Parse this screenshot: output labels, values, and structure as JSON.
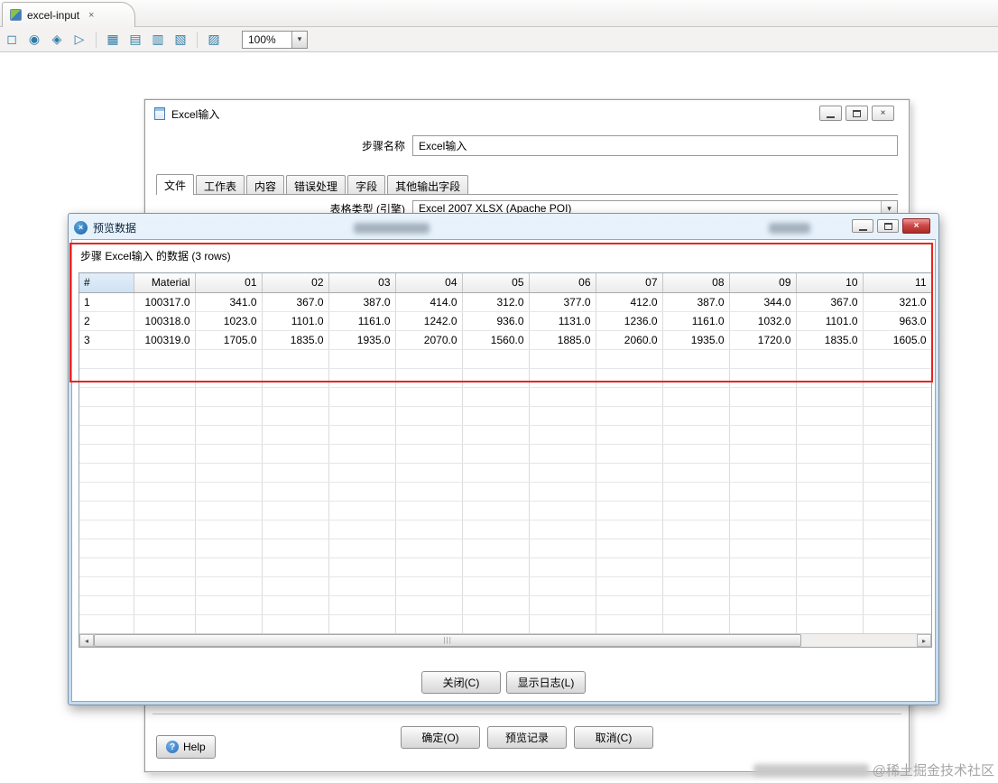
{
  "workspace": {
    "tab_label": "excel-input",
    "zoom_value": "100%"
  },
  "icons": {
    "close": "×",
    "dropdown_arrow": "▾",
    "scroll_left": "◂",
    "scroll_right": "▸",
    "scroll_grip": "|||",
    "help_glyph": "?",
    "logo_glyph": "×",
    "toolbar": [
      "◻",
      "◉",
      "◈",
      "▷",
      "▦",
      "▤",
      "▥",
      "▧",
      "▨"
    ]
  },
  "excel_dialog": {
    "title": "Excel输入",
    "step_name_label": "步骤名称",
    "step_name_value": "Excel输入",
    "tabs": [
      {
        "label": "文件"
      },
      {
        "label": "工作表"
      },
      {
        "label": "内容"
      },
      {
        "label": "错误处理"
      },
      {
        "label": "字段"
      },
      {
        "label": "其他输出字段"
      }
    ],
    "sheet_type_label": "表格类型 (引擎)",
    "sheet_type_value": "Excel 2007 XLSX (Apache POI)",
    "help_label": "Help",
    "ok_label": "确定(O)",
    "preview_label": "预览记录",
    "cancel_label": "取消(C)"
  },
  "preview_dialog": {
    "title": "预览数据",
    "subtitle": "步骤 Excel输入 的数据  (3 rows)",
    "table": {
      "columns": [
        "#",
        "Material",
        "01",
        "02",
        "03",
        "04",
        "05",
        "06",
        "07",
        "08",
        "09",
        "10",
        "11"
      ],
      "rows": [
        [
          "1",
          "100317.0",
          "341.0",
          "367.0",
          "387.0",
          "414.0",
          "312.0",
          "377.0",
          "412.0",
          "387.0",
          "344.0",
          "367.0",
          "321.0"
        ],
        [
          "2",
          "100318.0",
          "1023.0",
          "1101.0",
          "1161.0",
          "1242.0",
          "936.0",
          "1131.0",
          "1236.0",
          "1161.0",
          "1032.0",
          "1101.0",
          "963.0"
        ],
        [
          "3",
          "100319.0",
          "1705.0",
          "1835.0",
          "1935.0",
          "2070.0",
          "1560.0",
          "1885.0",
          "2060.0",
          "1935.0",
          "1720.0",
          "1835.0",
          "1605.0"
        ]
      ]
    },
    "close_label": "关闭(C)",
    "show_log_label": "显示日志(L)"
  },
  "watermark_text": "@稀土掘金技术社区"
}
